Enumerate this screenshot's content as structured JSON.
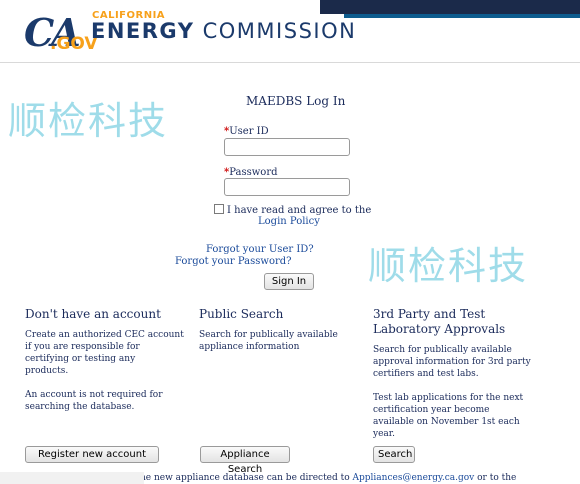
{
  "header": {
    "logo_ca": "CA",
    "logo_gov": ".GOV",
    "brand_top": "CALIFORNIA",
    "brand_main_1": "ENERGY",
    "brand_main_2": "COMMISSION"
  },
  "watermark": "顺检科技",
  "login": {
    "title": "MAEDBS Log In",
    "user_id_label": "User ID",
    "password_label": "Password",
    "required_mark": "*",
    "agree_text": "I have read and agree to the",
    "login_policy": "Login Policy",
    "forgot_user": "Forgot your User ID?",
    "forgot_password": "Forgot your Password?",
    "sign_in": "Sign In"
  },
  "columns": [
    {
      "title": "Don't have an account",
      "text": "Create an authorized CEC account\nif you are responsible for\ncertifying or testing any\nproducts.\n\nAn account is not required for\nsearching the database.",
      "button": "Register new account"
    },
    {
      "title": "Public Search",
      "text": "Search for publically available\nappliance information",
      "button": "Appliance Search"
    },
    {
      "title": "3rd Party and Test\nLaboratory Approvals",
      "text": "Search for publically available\napproval information for 3rd party\ncertifiers and test labs.\n\nTest lab applications for the next\ncertification year become\navailable on November 1st each\nyear.",
      "button": "Search"
    }
  ],
  "footer": {
    "text_before": "he new appliance database can be directed to ",
    "email": "Appliances@energy.ca.gov",
    "text_after": " or to the"
  }
}
